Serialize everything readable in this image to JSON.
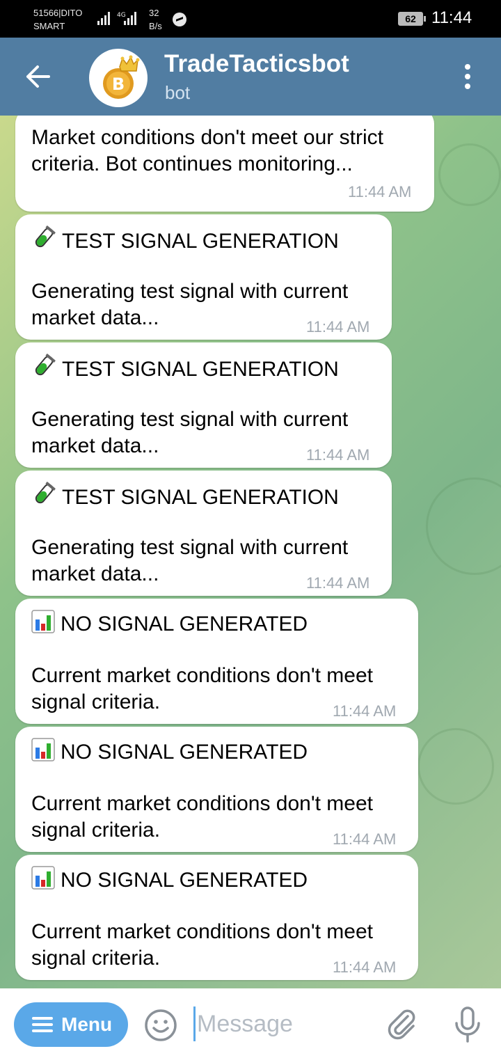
{
  "status_bar": {
    "carrier_line1": "51566|DITO",
    "carrier_line2": "SMART",
    "network_speed_value": "32",
    "network_speed_unit": "B/s",
    "network_type": "4G",
    "battery": "62",
    "time": "11:44"
  },
  "header": {
    "title": "TradeTacticsbot",
    "subtitle": "bot",
    "back_icon": "arrow-left-icon",
    "more_icon": "more-vertical-icon",
    "avatar_icon": "bitcoin-crown-icon"
  },
  "messages": [
    {
      "title": "",
      "body": [
        "Market conditions don't meet our strict",
        "criteria. Bot continues monitoring..."
      ],
      "time": "11:44 AM"
    },
    {
      "icon": "test-tube-icon",
      "title": "TEST SIGNAL GENERATION",
      "body": [
        "Generating test signal with current",
        "market data..."
      ],
      "time": "11:44 AM"
    },
    {
      "icon": "test-tube-icon",
      "title": "TEST SIGNAL GENERATION",
      "body": [
        "Generating test signal with current",
        "market data..."
      ],
      "time": "11:44 AM"
    },
    {
      "icon": "test-tube-icon",
      "title": "TEST SIGNAL GENERATION",
      "body": [
        "Generating test signal with current",
        "market data..."
      ],
      "time": "11:44 AM"
    },
    {
      "icon": "bar-chart-icon",
      "title": "NO SIGNAL GENERATED",
      "body": [
        "Current market conditions don't meet",
        "signal criteria."
      ],
      "time": "11:44 AM"
    },
    {
      "icon": "bar-chart-icon",
      "title": "NO SIGNAL GENERATED",
      "body": [
        "Current market conditions don't meet",
        "signal criteria."
      ],
      "time": "11:44 AM"
    },
    {
      "icon": "bar-chart-icon",
      "title": "NO SIGNAL GENERATED",
      "body": [
        "Current market conditions don't meet",
        "signal criteria."
      ],
      "time": "11:44 AM"
    }
  ],
  "input_bar": {
    "menu_label": "Menu",
    "placeholder": "Message",
    "emoji_icon": "smiley-icon",
    "attach_icon": "paperclip-icon",
    "mic_icon": "microphone-icon"
  },
  "colors": {
    "header_bg": "#517da2",
    "menu_button": "#5aa8e8",
    "bubble_bg": "#ffffff",
    "timestamp": "#a0a8b0"
  }
}
